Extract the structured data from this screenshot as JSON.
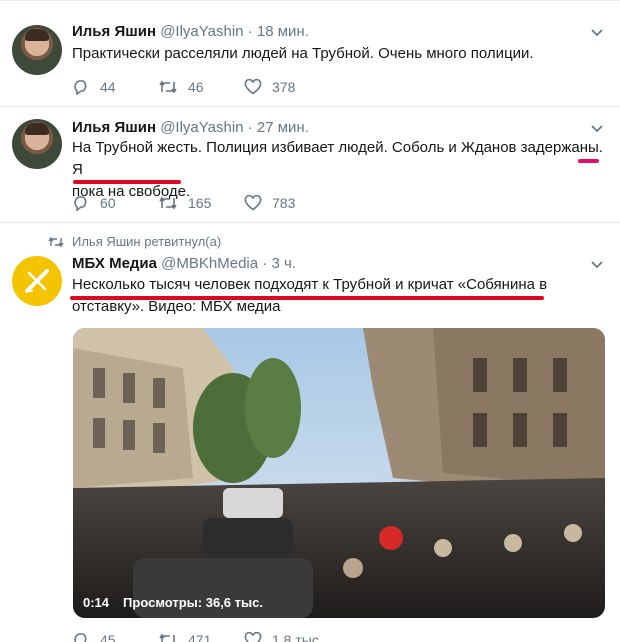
{
  "tweets": [
    {
      "name": "Илья Яшин",
      "handle": "@IlyaYashin",
      "dot": "·",
      "time": "18 мин.",
      "text": "Практически расселяли людей на Трубной. Очень много полиции.",
      "replies": "44",
      "retweets": "46",
      "likes": "378"
    },
    {
      "name": "Илья Яшин",
      "handle": "@IlyaYashin",
      "dot": "·",
      "time": "27 мин.",
      "text_line1": "На Трубной жесть. Полиция избивает людей. Соболь и Жданов задержаны. Я",
      "text_line2": "пока на свободе.",
      "replies": "60",
      "retweets": "165",
      "likes": "783"
    },
    {
      "retweet_note": "Илья Яшин ретвитнул(а)",
      "name": "МБХ Медиа",
      "handle": "@MBKhMedia",
      "dot": "·",
      "time": "3 ч.",
      "text_line1": "Несколько тысяч человек подходят к Трубной и кричат «Собянина в",
      "text_line2": "отставку». Видео: МБХ медиа",
      "video_time": "0:14",
      "video_views": "Просмотры: 36,6 тыс.",
      "replies": "45",
      "retweets": "471",
      "likes": "1,8 тыс."
    }
  ],
  "colors": {
    "underline_red": "#e0061f",
    "underline_pink": "#e0106e",
    "secondary_text": "#657786",
    "avatar_mbh": "#f5c400"
  },
  "icons": [
    "reply-icon",
    "retweet-icon",
    "like-icon",
    "chevron-down-icon",
    "retweet-small-icon"
  ]
}
